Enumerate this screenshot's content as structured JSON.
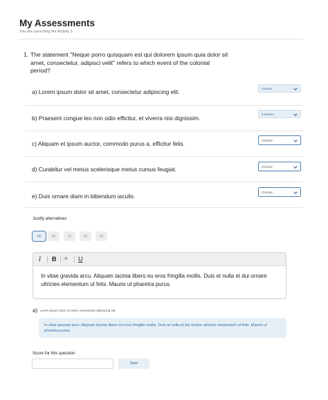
{
  "page": {
    "title": "My Assessments",
    "subtitle": "You are correcting the Activity 1."
  },
  "question": {
    "number": "1.",
    "text": "The statement \"Neque porro quisquam est qui dolorem ipsum quia dolor sit amet, consectetur, adipisci velit\" refers to which event of the colonial period?"
  },
  "answers": [
    {
      "text": "a) Lorem ipsum dolor sit amet, consectetur adipiscing elit.",
      "status": "Correct"
    },
    {
      "text": "b) Praesent congue leo non odio efficitur, et viverra nisi dignissim.",
      "status": "Incorrect"
    },
    {
      "text": "c) Aliquam  et ipsum auctor, commodo purus a, efficitur felis.",
      "status": "Choose"
    },
    {
      "text": "d)  Curabitur vel metus  scelerisque metus cursus feugiat.",
      "status": "Choose"
    },
    {
      "text": "e) Duis ornare diam in bibendum iaculis.",
      "status": "Choose"
    }
  ],
  "justify": {
    "label": "Justify alternatives",
    "alternatives": [
      "a)",
      "b)",
      "c)",
      "d)",
      "e)"
    ],
    "active": "a)"
  },
  "editor": {
    "toolbar": {
      "italic": "I",
      "bold": "B",
      "list": "⁝≡",
      "underline": "U"
    },
    "text": "In vitae gravida arcu. Aliquam lacinia libero eu eros fringilla mollis. Duis et nulla et dui ornare ultricies elementum ut felis. Mauris ut pharetra purus."
  },
  "response": {
    "letter": "a)",
    "label": "Lorem ipsum dolor sit amet, consectetur adipiscing elit.",
    "text": "In vitae gravida arcu. Aliquam lacinia libero eu eros fringilla mollis. Duis at nulla et dui ornare ultricies elementum ut felis. Mauris ut pharetra purus."
  },
  "score": {
    "label": "Score for this question",
    "value": "",
    "save_label": "Save"
  },
  "colors": {
    "accent": "#4a7fb0",
    "accent_light": "#e7eff6",
    "accent_text": "#2f6ea6"
  }
}
